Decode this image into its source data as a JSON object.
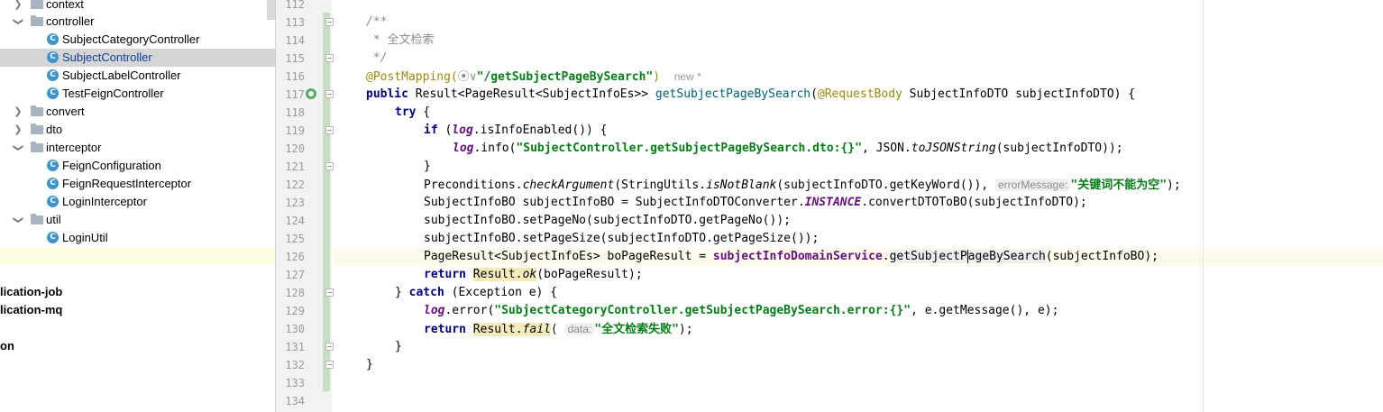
{
  "project_tree": {
    "items": [
      {
        "label": "context",
        "kind": "folder",
        "expanded": false
      },
      {
        "label": "controller",
        "kind": "folder",
        "expanded": true
      },
      {
        "label": "SubjectCategoryController",
        "kind": "class"
      },
      {
        "label": "SubjectController",
        "kind": "class",
        "selected": true
      },
      {
        "label": "SubjectLabelController",
        "kind": "class"
      },
      {
        "label": "TestFeignController",
        "kind": "class"
      },
      {
        "label": "convert",
        "kind": "folder",
        "expanded": false
      },
      {
        "label": "dto",
        "kind": "folder",
        "expanded": false
      },
      {
        "label": "interceptor",
        "kind": "folder",
        "expanded": true
      },
      {
        "label": "FeignConfiguration",
        "kind": "class"
      },
      {
        "label": "FeignRequestInterceptor",
        "kind": "class"
      },
      {
        "label": "LoginInterceptor",
        "kind": "class"
      },
      {
        "label": "util",
        "kind": "folder",
        "expanded": true
      },
      {
        "label": "LoginUtil",
        "kind": "class"
      }
    ],
    "modules": [
      "lication-job",
      "lication-mq",
      "on"
    ],
    "class_icon_letter": "C"
  },
  "editor": {
    "line_numbers": [
      "112",
      "113",
      "114",
      "115",
      "116",
      "117",
      "118",
      "119",
      "120",
      "121",
      "122",
      "123",
      "124",
      "125",
      "126",
      "127",
      "128",
      "129",
      "130",
      "131",
      "132",
      "133",
      "134"
    ],
    "code": {
      "l113": "/**",
      "l114_star": " * ",
      "l114_text": "全文检索",
      "l115": " */",
      "l116_ann": "@PostMapping(",
      "l116_icon": "⦿∨",
      "l116_str": "\"/getSubjectPageBySearch\"",
      "l116_close": ")",
      "l116_usage": "new *",
      "l117_public": "public",
      "l117_type": " Result<PageResult<SubjectInfoEs>> ",
      "l117_method": "getSubjectPageBySearch",
      "l117_paren": "(",
      "l117_ann": "@RequestBody",
      "l117_rest": " SubjectInfoDTO subjectInfoDTO) {",
      "l118_try": "try",
      "l118_rest": " {",
      "l119_if": "if",
      "l119_a": " (",
      "l119_log": "log",
      "l119_b": ".isInfoEnabled()) {",
      "l120_log": "log",
      "l120_a": ".info(",
      "l120_str": "\"SubjectController.getSubjectPageBySearch.dto:{}\"",
      "l120_b": ", JSON.",
      "l120_static": "toJSONString",
      "l120_c": "(subjectInfoDTO));",
      "l121": "}",
      "l122_a": "Preconditions.",
      "l122_static1": "checkArgument",
      "l122_b": "(StringUtils.",
      "l122_static2": "isNotBlank",
      "l122_c": "(subjectInfoDTO.getKeyWord()), ",
      "l122_hint": "errorMessage:",
      "l122_str": "\"关键词不能为空\"",
      "l122_d": ");",
      "l123_a": "SubjectInfoBO subjectInfoBO = SubjectInfoDTOConverter.",
      "l123_field": "INSTANCE",
      "l123_b": ".convertDTOToBO(subjectInfoDTO);",
      "l124": "subjectInfoBO.setPageNo(subjectInfoDTO.getPageNo());",
      "l125": "subjectInfoBO.setPageSize(subjectInfoDTO.getPageSize());",
      "l126_a": "PageResult<SubjectInfoEs> boPageResult = ",
      "l126_field": "subjectInfoDomainService",
      "l126_dot": ".",
      "l126_meth1": "getSubjectP",
      "l126_meth2": "ageBySearch",
      "l126_b": "(subjectInfoBO);",
      "l127_return": "return",
      "l127_sp": " ",
      "l127_res": "Result.",
      "l127_ok": "ok",
      "l127_b": "(boPageResult);",
      "l128_a": "} ",
      "l128_catch": "catch",
      "l128_b": " (Exception e) {",
      "l129_log": "log",
      "l129_a": ".error(",
      "l129_str": "\"SubjectCategoryController.getSubjectPageBySearch.error:{}\"",
      "l129_b": ", e.getMessage(), e);",
      "l130_return": "return",
      "l130_sp": " ",
      "l130_res": "Result.",
      "l130_fail": "fail",
      "l130_a": "( ",
      "l130_hint": "data:",
      "l130_str": "\"全文检索失败\"",
      "l130_b": ");",
      "l131": "}",
      "l132": "}"
    }
  }
}
